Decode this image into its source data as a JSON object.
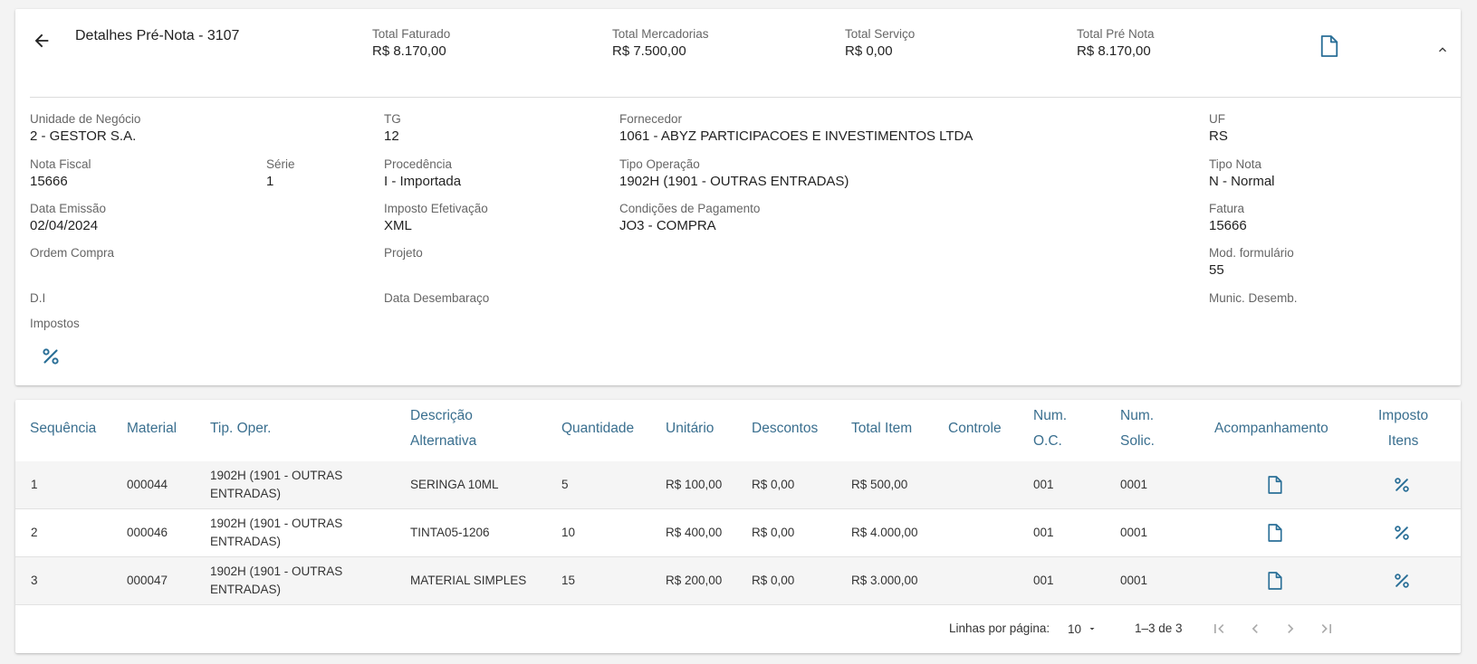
{
  "header": {
    "title": "Detalhes Pré-Nota - 3107",
    "totals": [
      {
        "label": "Total Faturado",
        "value": "R$ 8.170,00"
      },
      {
        "label": "Total Mercadorias",
        "value": "R$ 7.500,00"
      },
      {
        "label": "Total Serviço",
        "value": "R$ 0,00"
      },
      {
        "label": "Total Pré Nota",
        "value": "R$ 8.170,00"
      }
    ]
  },
  "details": {
    "unidade": {
      "label": "Unidade de Negócio",
      "value": "2 - GESTOR S.A."
    },
    "tg": {
      "label": "TG",
      "value": "12"
    },
    "fornecedor": {
      "label": "Fornecedor",
      "value": "1061 - ABYZ PARTICIPACOES E INVESTIMENTOS LTDA"
    },
    "uf": {
      "label": "UF",
      "value": "RS"
    },
    "nota_fiscal": {
      "label": "Nota Fiscal",
      "value": "15666"
    },
    "serie": {
      "label": "Série",
      "value": "1"
    },
    "procedencia": {
      "label": "Procedência",
      "value": "I - Importada"
    },
    "tipo_operacao": {
      "label": "Tipo Operação",
      "value": "1902H (1901 - OUTRAS ENTRADAS)"
    },
    "tipo_nota": {
      "label": "Tipo Nota",
      "value": "N - Normal"
    },
    "data_emissao": {
      "label": "Data Emissão",
      "value": "02/04/2024"
    },
    "imposto_efetivacao": {
      "label": "Imposto Efetivação",
      "value": "XML"
    },
    "condicoes": {
      "label": "Condições de Pagamento",
      "value": "JO3 - COMPRA"
    },
    "fatura": {
      "label": "Fatura",
      "value": "15666"
    },
    "ordem_compra": {
      "label": "Ordem Compra",
      "value": ""
    },
    "projeto": {
      "label": "Projeto",
      "value": ""
    },
    "mod_formulario": {
      "label": "Mod. formulário",
      "value": "55"
    },
    "di": {
      "label": "D.I",
      "value": ""
    },
    "data_desembaraco": {
      "label": "Data Desembaraço",
      "value": ""
    },
    "munic_desemb": {
      "label": "Munic. Desemb.",
      "value": ""
    },
    "impostos": {
      "label": "Impostos"
    }
  },
  "table": {
    "columns": {
      "sequencia": "Sequência",
      "material": "Material",
      "tip_oper": "Tip. Oper.",
      "descricao_1": "Descrição",
      "descricao_2": "Alternativa",
      "quantidade": "Quantidade",
      "unitario": "Unitário",
      "descontos": "Descontos",
      "total_item": "Total Item",
      "controle": "Controle",
      "num_oc_1": "Num.",
      "num_oc_2": "O.C.",
      "num_solic_1": "Num.",
      "num_solic_2": "Solic.",
      "acompanhamento": "Acompanhamento",
      "imposto_1": "Imposto",
      "imposto_2": "Itens"
    },
    "rows": [
      {
        "seq": "1",
        "material": "000044",
        "tip_oper": "1902H (1901 - OUTRAS ENTRADAS)",
        "descricao": "SERINGA 10ML",
        "quantidade": "5",
        "unitario": "R$ 100,00",
        "descontos": "R$ 0,00",
        "total": "R$ 500,00",
        "controle": "",
        "num_oc": "001",
        "num_solic": "0001"
      },
      {
        "seq": "2",
        "material": "000046",
        "tip_oper": "1902H (1901 - OUTRAS ENTRADAS)",
        "descricao": "TINTA05-1206",
        "quantidade": "10",
        "unitario": "R$ 400,00",
        "descontos": "R$ 0,00",
        "total": "R$ 4.000,00",
        "controle": "",
        "num_oc": "001",
        "num_solic": "0001"
      },
      {
        "seq": "3",
        "material": "000047",
        "tip_oper": "1902H (1901 - OUTRAS ENTRADAS)",
        "descricao": "MATERIAL SIMPLES",
        "quantidade": "15",
        "unitario": "R$ 200,00",
        "descontos": "R$ 0,00",
        "total": "R$ 3.000,00",
        "controle": "",
        "num_oc": "001",
        "num_solic": "0001"
      }
    ]
  },
  "pager": {
    "rows_label": "Linhas por página:",
    "rows_per_page": "10",
    "range": "1–3 de 3"
  },
  "colors": {
    "accent": "#2a6f97",
    "header_text": "#3a6f8f",
    "row_shade": "#f5f5f5"
  }
}
